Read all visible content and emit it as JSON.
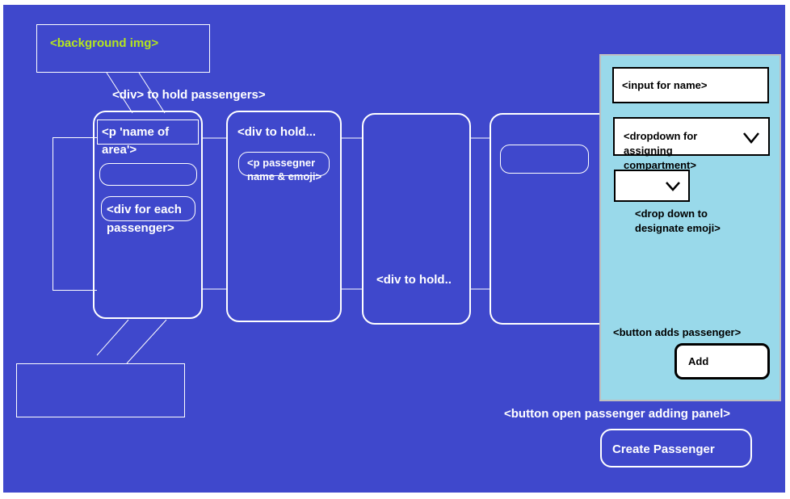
{
  "colors": {
    "background": "#3f48cc",
    "panel": "#99d9ea",
    "highlight": "#b5e61d",
    "line": "#ffffff"
  },
  "labels": {
    "background_img": "<background img>",
    "div_hold_passengers": "<div> to hold passengers>",
    "p_name_line1": "<p 'name of",
    "p_name_line2": "area'>",
    "div_each_line1": "<div for each",
    "div_each_line2": "passenger>",
    "div_to_hold_1": "<div to hold...",
    "p_passenger_line1": "<p passegner",
    "p_passenger_line2": "name & emoji>",
    "div_to_hold_2": "<div to hold..",
    "button_open_panel": "<button open passenger adding panel>",
    "create_passenger": "Create Passenger"
  },
  "panel": {
    "input_name": "<input for name>",
    "dropdown_line1": "<dropdown for",
    "dropdown_line2": "assigning",
    "dropdown_line3": "compartment>",
    "emoji_line1": "<drop down to",
    "emoji_line2": "designate emoji>",
    "button_adds": "<button adds passenger>",
    "add_label": "Add",
    "chevron_icon": "chevron-down-icon"
  }
}
